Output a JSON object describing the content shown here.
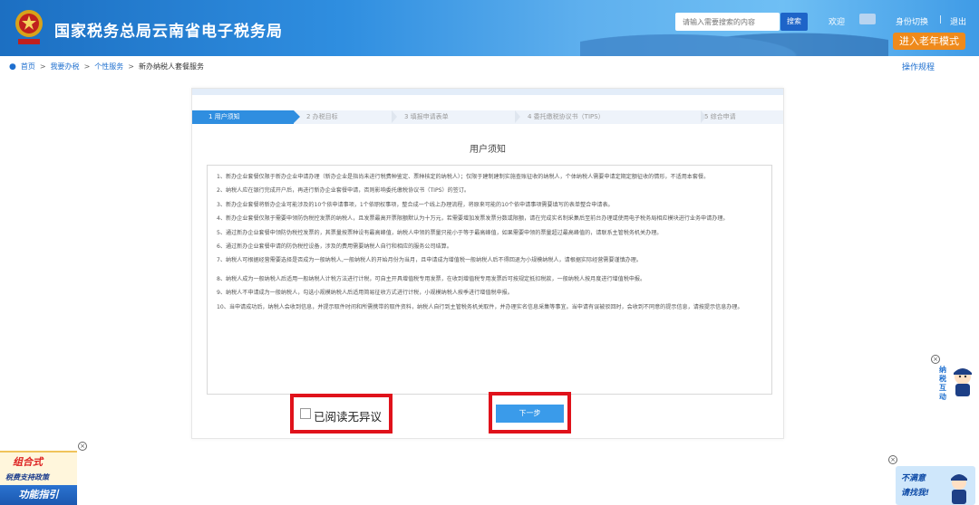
{
  "header": {
    "site_title": "国家税务总局云南省电子税务局",
    "search_placeholder": "请输入需要搜索的内容",
    "search_button": "搜索",
    "welcome": "欢迎",
    "identity_switch": "身份切换",
    "separator": "|",
    "logout": "退出",
    "elder_mode": "进入老年模式",
    "colors": {
      "bar": "#2f8ee0",
      "elder_button": "#ef8a1b"
    }
  },
  "breadcrumb": {
    "items": [
      "首页",
      "我要办税",
      "个性服务",
      "新办纳税人套餐服务"
    ],
    "operation_rules": "操作规程"
  },
  "steps": [
    {
      "label": "1 用户须知",
      "active": true
    },
    {
      "label": "2 办税目标",
      "active": false
    },
    {
      "label": "3 填报申请表单",
      "active": false
    },
    {
      "label": "4 委托缴税协议书（TIPS）",
      "active": false
    },
    {
      "label": "5 综合申请",
      "active": false
    }
  ],
  "notice": {
    "title": "用户须知",
    "items": [
      "1、新办企业套餐仅限于新办企业申请办理（新办企业是指尚未进行税费种鉴定、票种核定的纳税人）；仅限于建制建制实施查账征收的纳税人，个体纳税人需要申请定期定额征收的情形，不适用本套餐。",
      "2、纳税人应在银行完成开户后，再进行新办企业套餐申请，否则影响委托缴税协议书（TIPS）的签订。",
      "3、新办企业套餐将新办企业可能涉及的10个依申请事项，1个依职权事项，整合成一个线上办理流程，将原来可能的10个依申请事项需要填写的表单整合申请表。",
      "4、新办企业套餐仅限于需要申领防伪税控发票的纳税人，且发票最高开票限额默认为十万元，若需要增加发票发票分数或限额，请在完成实名制采集后至前台办理或使用电子税务局相应模块进行业务申请办理。",
      "5、通过新办企业套餐申领防伪税控发票的，其票量按票种设有最高峰值，纳税人申领的票量只能小于等于最高峰值，如果需要申领的票量超过最高峰值的，请联系主管税务机关办理。",
      "6、通过新办企业套餐申请的防伪税控设备，涉及的费用需要纳税人自行和相应的服务公司结算。",
      "7、纳税人可根据经营需要选择是否成为一般纳税人,一般纳税人的开始月份为当月，且申请成为增值税一般纳税人后不得回退为小规模纳税人，请根据实际经营需要谨慎办理。",
      "8、纳税人成为一般纳税人后适用一般纳税人计税方法进行计税，可自主开具增值税专用发票，在收到增值税专用发票后可按规定抵扣税款，一般纳税人按月度进行增值税申报。",
      "9、纳税人不申请成为一般纳税人，勾选小规模纳税人后适用简易征收方式进行计税，小规模纳税人按季进行增值税申报。",
      "10、当申请成功后，纳税人会收到信息，并提示取件时间和所需携带的取件资料，纳税人自行到主管税务机关取件，并办理实名信息采集等事宜。当申请有误被驳回时，会收到不同意的提示信息，请按提示信息办理。"
    ]
  },
  "actions": {
    "agree_label": "已阅读无异议",
    "agree_checked": false,
    "next_button": "下一步"
  },
  "floats": {
    "close_symbol": "×",
    "interact_label": "纳税互动",
    "promo_line1": "组合式",
    "promo_line2": "税费支持政策",
    "promo_line3": "功能指引",
    "complaint_line1": "不满意",
    "complaint_line2": "请找我!"
  }
}
